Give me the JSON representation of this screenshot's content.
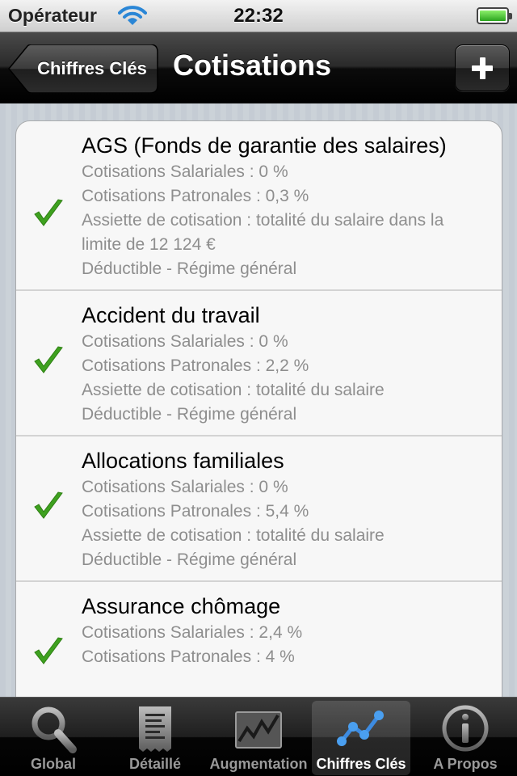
{
  "status_bar": {
    "carrier": "Opérateur",
    "time": "22:32"
  },
  "nav": {
    "back_label": "Chiffres Clés",
    "title": "Cotisations",
    "add_symbol": "+"
  },
  "items": [
    {
      "title": "AGS (Fonds de garantie des salaires)",
      "lines": [
        "Cotisations Salariales : 0 %",
        "Cotisations Patronales : 0,3 %",
        "Assiette de cotisation : totalité du salaire dans la limite de 12 124 €",
        "Déductible - Régime général"
      ]
    },
    {
      "title": "Accident du travail",
      "lines": [
        "Cotisations Salariales : 0 %",
        "Cotisations Patronales : 2,2 %",
        "Assiette de cotisation : totalité du salaire",
        "Déductible - Régime général"
      ]
    },
    {
      "title": "Allocations familiales",
      "lines": [
        "Cotisations Salariales : 0 %",
        "Cotisations Patronales : 5,4 %",
        "Assiette de cotisation : totalité du salaire",
        "Déductible - Régime général"
      ]
    },
    {
      "title": "Assurance chômage",
      "lines": [
        "Cotisations Salariales : 2,4 %",
        "Cotisations Patronales : 4 %"
      ]
    }
  ],
  "tabs": [
    {
      "label": "Global",
      "icon": "magnifier-icon"
    },
    {
      "label": "Détaillé",
      "icon": "document-icon"
    },
    {
      "label": "Augmentation",
      "icon": "line-chart-icon"
    },
    {
      "label": "Chiffres Clés",
      "icon": "nodes-chart-icon"
    },
    {
      "label": "A Propos",
      "icon": "info-icon"
    }
  ],
  "active_tab": 3,
  "colors": {
    "check_green": "#3ea11f",
    "secondary_text": "#8e8e8e",
    "nav_black": "#000000",
    "active_tab_icon": "#3d8be0"
  }
}
